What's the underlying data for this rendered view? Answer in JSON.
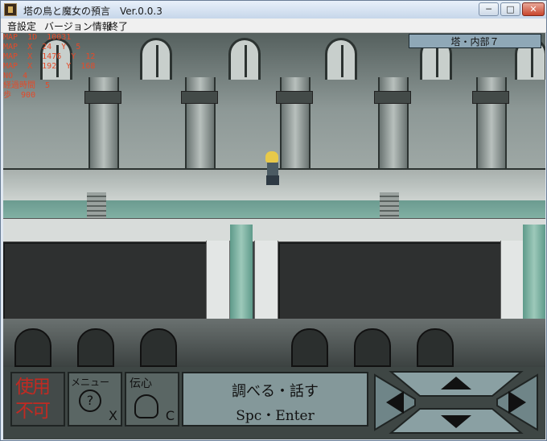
{
  "window": {
    "title": "塔の鳥と魔女の預言　Ver.0.0.3",
    "minimize": "─",
    "maximize": "□",
    "close": "✕"
  },
  "menu": [
    "音設定",
    "バージョン情報",
    "終了"
  ],
  "debug_lines": [
    "MAP  1D  10031",
    "MAP  X  24  Y  5",
    "MAP  X  1476  Y  12",
    "MAP  X  192  Y  168",
    "NO  4",
    "経過時間  5",
    "歩  900"
  ],
  "location": "塔・内部７",
  "hud": {
    "use": {
      "line1": "使用",
      "line2": "不可"
    },
    "menu": {
      "label": "メニュー",
      "symbol": "?",
      "key": "X"
    },
    "telepathy": {
      "label": "伝心",
      "key": "C"
    },
    "talk": {
      "line1": "調べる・話す",
      "line2": "Spc・Enter"
    }
  },
  "colors": {
    "debug_text": "#e34b2a",
    "use_disabled": "#c12a22",
    "location_bg": "#8fa8b7"
  },
  "icons": {
    "app": "game-app-icon",
    "up": "arrow-up-icon",
    "down": "arrow-down-icon",
    "left": "arrow-left-icon",
    "right": "arrow-right-icon"
  }
}
